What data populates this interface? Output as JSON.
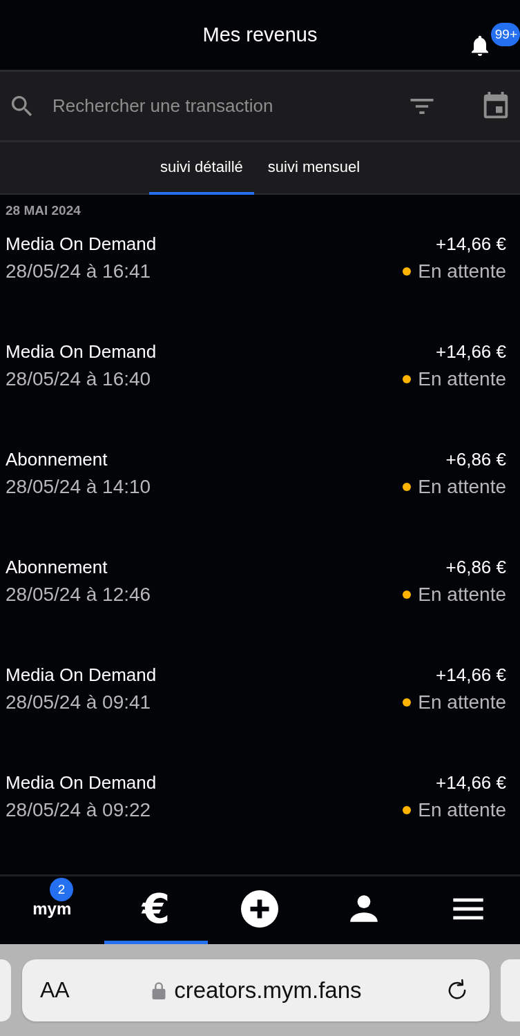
{
  "header": {
    "title": "Mes revenus",
    "notification_badge": "99+"
  },
  "search": {
    "placeholder": "Rechercher une transaction"
  },
  "tabs": [
    {
      "label": "suivi détaillé",
      "selected": true
    },
    {
      "label": "suivi mensuel",
      "selected": false
    }
  ],
  "date_group": "28 MAI 2024",
  "transactions": [
    {
      "title": "Media On Demand",
      "date": "28/05/24 à 16:41",
      "amount": "+14,66 €",
      "status": "En attente",
      "color": "#ffb400"
    },
    {
      "title": "Media On Demand",
      "date": "28/05/24 à 16:40",
      "amount": "+14,66 €",
      "status": "En attente",
      "color": "#ffb400"
    },
    {
      "title": "Abonnement",
      "date": "28/05/24 à 14:10",
      "amount": "+6,86 €",
      "status": "En attente",
      "color": "#ffb400"
    },
    {
      "title": "Abonnement",
      "date": "28/05/24 à 12:46",
      "amount": "+6,86 €",
      "status": "En attente",
      "color": "#ffb400"
    },
    {
      "title": "Media On Demand",
      "date": "28/05/24 à 09:41",
      "amount": "+14,66 €",
      "status": "En attente",
      "color": "#ffb400"
    },
    {
      "title": "Media On Demand",
      "date": "28/05/24 à 09:22",
      "amount": "+14,66 €",
      "status": "En attente",
      "color": "#ffb400"
    }
  ],
  "bottom_nav": [
    {
      "kind": "logo",
      "label": "mym",
      "badge": "2",
      "selected": false
    },
    {
      "kind": "euro",
      "label": "€",
      "selected": true
    },
    {
      "kind": "add",
      "selected": false
    },
    {
      "kind": "profile",
      "selected": false
    },
    {
      "kind": "menu",
      "selected": false
    }
  ],
  "browser": {
    "text_size": "AA",
    "url": "creators.mym.fans"
  }
}
